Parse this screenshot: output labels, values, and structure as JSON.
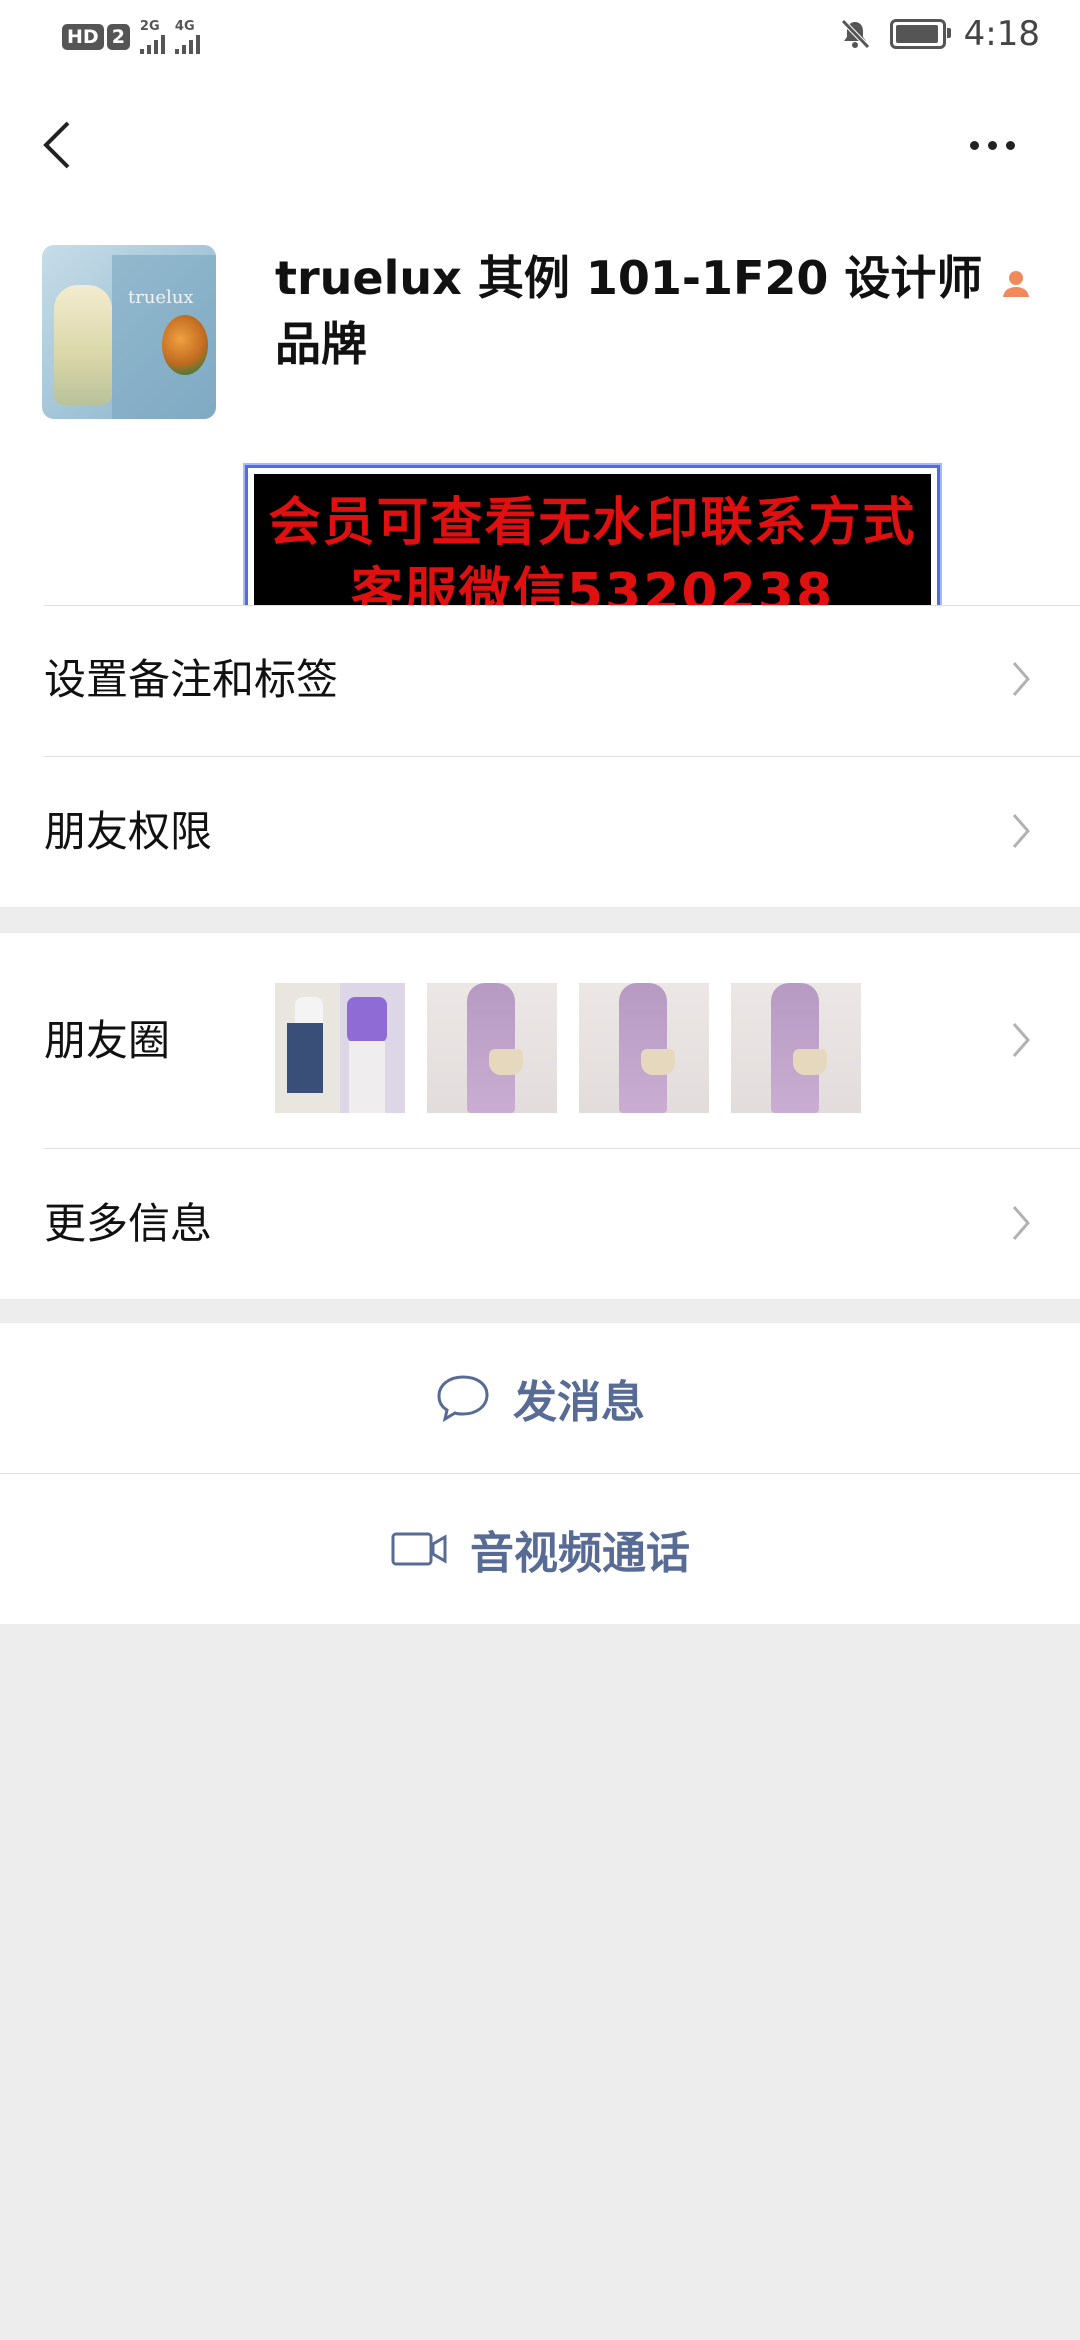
{
  "status_bar": {
    "hd_label": "HD",
    "sim_label": "2",
    "net1": "2G",
    "net2": "4G",
    "time": "4:18"
  },
  "profile": {
    "name": "truelux 其例 101-1F20 设计师品牌",
    "avatar_text": "truelux",
    "watermark_line1": "会员可查看无水印联系方式",
    "watermark_line2": "客服微信5320238"
  },
  "menu": {
    "remarks_label": "设置备注和标签",
    "permissions_label": "朋友权限",
    "moments_label": "朋友圈",
    "more_info_label": "更多信息"
  },
  "actions": {
    "message_label": "发消息",
    "call_label": "音视频通话"
  },
  "colors": {
    "link": "#576b95",
    "watermark_text": "#e01010",
    "background": "#ededed"
  },
  "icons": {
    "back": "chevron-left-icon",
    "more": "more-dots-icon",
    "contact": "contact-person-icon",
    "chat": "chat-bubble-icon",
    "video": "video-camera-icon"
  }
}
